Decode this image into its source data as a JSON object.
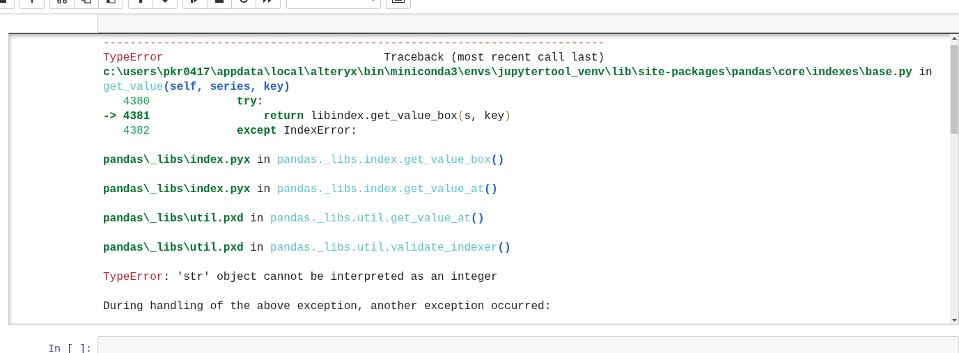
{
  "output": {
    "blocks": [
      {
        "lines": [
          {
            "segments": [
              {
                "kind": "rule",
                "text": "---------------------------------------------------------------------------"
              }
            ]
          },
          {
            "segments": [
              {
                "kind": "ename",
                "text": "TypeError"
              },
              {
                "kind": "plain",
                "text": "                                 Traceback (most recent call last)"
              }
            ]
          },
          {
            "segments": [
              {
                "kind": "file",
                "text": "c:\\users\\pkr0417\\appdata\\local\\alteryx\\bin\\miniconda3\\envs\\jupytertool_venv\\lib\\site-packages\\pandas\\core\\indexes\\base.py"
              },
              {
                "kind": "plain",
                "text": " in"
              }
            ]
          },
          {
            "segments": [
              {
                "kind": "func",
                "text": "get_value"
              },
              {
                "kind": "args",
                "text": "(self, series, key)"
              }
            ]
          },
          {
            "segments": [
              {
                "kind": "lineno",
                "text": "   4380             "
              },
              {
                "kind": "keyword",
                "text": "try"
              },
              {
                "kind": "plain",
                "text": ":"
              }
            ]
          },
          {
            "segments": [
              {
                "kind": "arrow",
                "text": "-> 4381                 "
              },
              {
                "kind": "keyword",
                "text": "return"
              },
              {
                "kind": "plain",
                "text": " libindex.get_value_box"
              },
              {
                "kind": "bracket",
                "text": "("
              },
              {
                "kind": "plain",
                "text": "s, key"
              },
              {
                "kind": "bracket",
                "text": ")"
              }
            ]
          },
          {
            "segments": [
              {
                "kind": "lineno",
                "text": "   4382             "
              },
              {
                "kind": "keyword",
                "text": "except"
              },
              {
                "kind": "plain",
                "text": " IndexError:"
              }
            ]
          }
        ]
      },
      {
        "lines": [
          {
            "segments": [
              {
                "kind": "file",
                "text": "pandas\\_libs\\index.pyx"
              },
              {
                "kind": "plain",
                "text": " in "
              },
              {
                "kind": "func",
                "text": "pandas._libs.index.get_value_box"
              },
              {
                "kind": "args",
                "text": "()"
              }
            ]
          }
        ]
      },
      {
        "lines": [
          {
            "segments": [
              {
                "kind": "file",
                "text": "pandas\\_libs\\index.pyx"
              },
              {
                "kind": "plain",
                "text": " in "
              },
              {
                "kind": "func",
                "text": "pandas._libs.index.get_value_at"
              },
              {
                "kind": "args",
                "text": "()"
              }
            ]
          }
        ]
      },
      {
        "lines": [
          {
            "segments": [
              {
                "kind": "file",
                "text": "pandas\\_libs\\util.pxd"
              },
              {
                "kind": "plain",
                "text": " in "
              },
              {
                "kind": "func",
                "text": "pandas._libs.util.get_value_at"
              },
              {
                "kind": "args",
                "text": "()"
              }
            ]
          }
        ]
      },
      {
        "lines": [
          {
            "segments": [
              {
                "kind": "file",
                "text": "pandas\\_libs\\util.pxd"
              },
              {
                "kind": "plain",
                "text": " in "
              },
              {
                "kind": "func",
                "text": "pandas._libs.util.validate_indexer"
              },
              {
                "kind": "args",
                "text": "()"
              }
            ]
          }
        ]
      },
      {
        "lines": [
          {
            "segments": [
              {
                "kind": "ename",
                "text": "TypeError"
              },
              {
                "kind": "plain",
                "text": ": 'str' object cannot be interpreted as an integer"
              }
            ]
          }
        ]
      },
      {
        "lines": [
          {
            "segments": [
              {
                "kind": "plain",
                "text": "During handling of the above exception, another exception occurred:"
              }
            ]
          }
        ]
      }
    ]
  },
  "next_cell": {
    "prompt": "In [ ]:"
  }
}
